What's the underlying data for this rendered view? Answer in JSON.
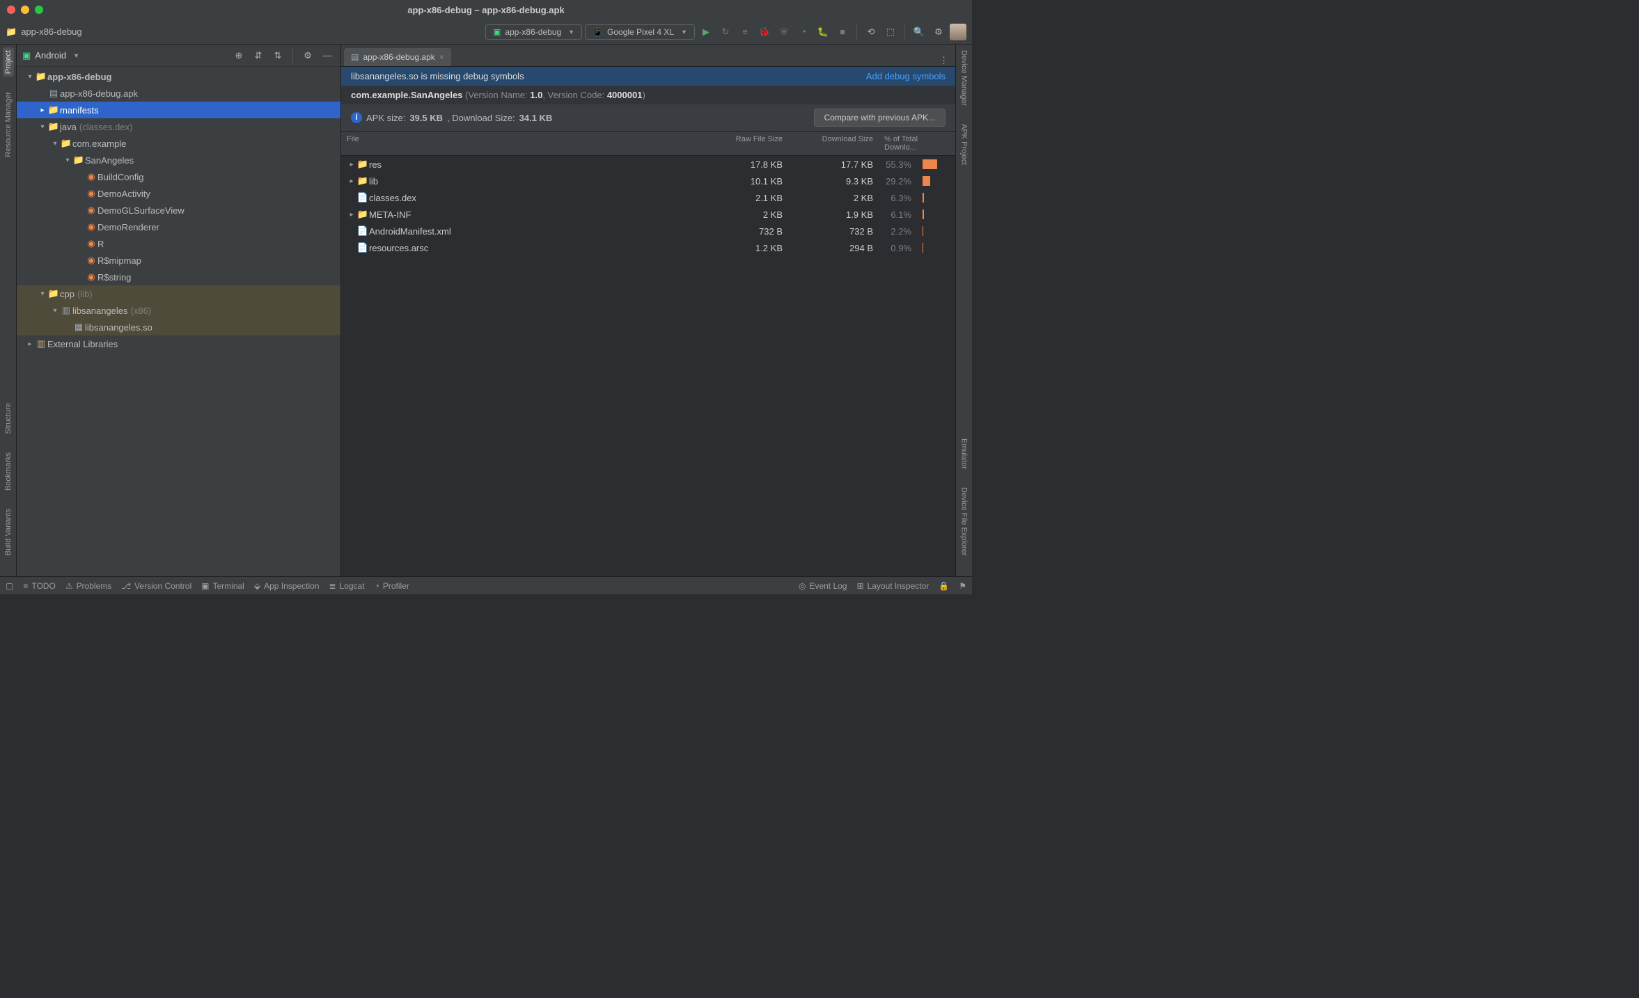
{
  "window": {
    "title": "app-x86-debug – app-x86-debug.apk"
  },
  "breadcrumb": "app-x86-debug",
  "config_combo": "app-x86-debug",
  "device_combo": "Google Pixel 4 XL",
  "left_tabs": {
    "project": "Project",
    "resource": "Resource Manager",
    "structure": "Structure",
    "bookmarks": "Bookmarks",
    "variants": "Build Variants"
  },
  "right_tabs": {
    "device_mgr": "Device Manager",
    "apk": "APK Project",
    "emulator": "Emulator",
    "device_file": "Device File Explorer"
  },
  "project": {
    "mode": "Android",
    "tree": {
      "root": "app-x86-debug",
      "apk": "app-x86-debug.apk",
      "manifests": "manifests",
      "java": "java",
      "java_hint": "(classes.dex)",
      "pkg": "com.example",
      "cls": "SanAngeles",
      "j1": "BuildConfig",
      "j2": "DemoActivity",
      "j3": "DemoGLSurfaceView",
      "j4": "DemoRenderer",
      "j5": "R",
      "j6": "R$mipmap",
      "j7": "R$string",
      "cpp": "cpp",
      "cpp_hint": "(lib)",
      "lib": "libsanangeles",
      "lib_hint": "(x86)",
      "so": "libsanangeles.so",
      "ext": "External Libraries"
    }
  },
  "editor": {
    "tab": "app-x86-debug.apk",
    "banner_msg": "libsanangeles.so is missing debug symbols",
    "banner_link": "Add debug symbols",
    "package": "com.example.SanAngeles",
    "version_label": "(Version Name: ",
    "version_name": "1.0",
    "version_mid": ", Version Code: ",
    "version_code": "4000001",
    "version_end": ")",
    "size_prefix": "APK size: ",
    "apk_size": "39.5 KB",
    "size_mid": ", Download Size: ",
    "dl_size": "34.1 KB",
    "compare_btn": "Compare with previous APK...",
    "cols": {
      "file": "File",
      "raw": "Raw File Size",
      "dl": "Download Size",
      "pct": "% of Total Downlo..."
    },
    "rows": [
      {
        "exp": true,
        "icon": "📁",
        "name": "res",
        "raw": "17.8 KB",
        "dl": "17.7 KB",
        "pct": "55.3%",
        "bar": 55
      },
      {
        "exp": true,
        "icon": "📁",
        "name": "lib",
        "raw": "10.1 KB",
        "dl": "9.3 KB",
        "pct": "29.2%",
        "bar": 29
      },
      {
        "exp": false,
        "icon": "📄",
        "name": "classes.dex",
        "raw": "2.1 KB",
        "dl": "2 KB",
        "pct": "6.3%",
        "bar": 6
      },
      {
        "exp": true,
        "icon": "📁",
        "name": "META-INF",
        "raw": "2 KB",
        "dl": "1.9 KB",
        "pct": "6.1%",
        "bar": 6
      },
      {
        "exp": false,
        "icon": "📄",
        "name": "AndroidManifest.xml",
        "raw": "732 B",
        "dl": "732 B",
        "pct": "2.2%",
        "bar": 2
      },
      {
        "exp": false,
        "icon": "📄",
        "name": "resources.arsc",
        "raw": "1.2 KB",
        "dl": "294 B",
        "pct": "0.9%",
        "bar": 1
      }
    ]
  },
  "status": {
    "todo": "TODO",
    "problems": "Problems",
    "vcs": "Version Control",
    "terminal": "Terminal",
    "inspect": "App Inspection",
    "logcat": "Logcat",
    "profiler": "Profiler",
    "events": "Event Log",
    "layout": "Layout Inspector"
  }
}
